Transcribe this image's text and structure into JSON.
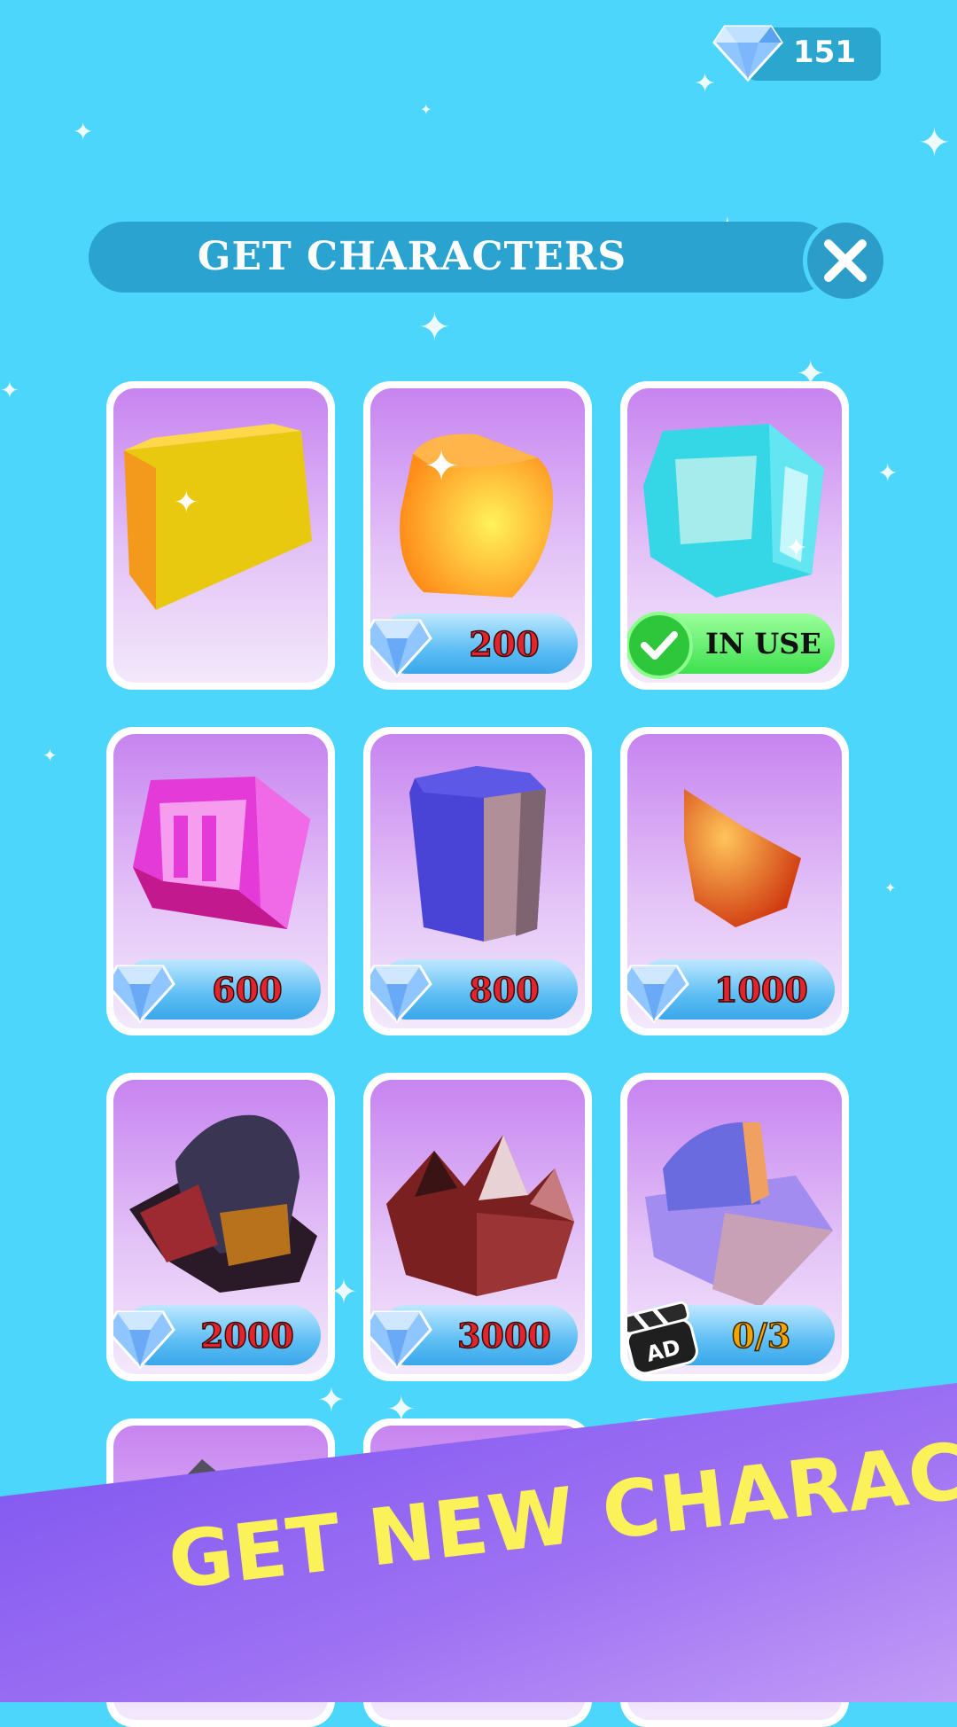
{
  "currency": {
    "gem_count": "151",
    "icon": "diamond-icon"
  },
  "header": {
    "title": "GET CHARACTERS",
    "close_icon": "close-icon"
  },
  "characters": [
    {
      "id": "yellow-cube",
      "status": "owned",
      "label": ""
    },
    {
      "id": "orange-cube",
      "status": "price",
      "label": "200"
    },
    {
      "id": "cyan-gem",
      "status": "in_use",
      "label": "IN USE"
    },
    {
      "id": "pink-gem",
      "status": "price",
      "label": "600"
    },
    {
      "id": "blue-prism",
      "status": "price",
      "label": "800"
    },
    {
      "id": "orange-shard",
      "status": "price",
      "label": "1000"
    },
    {
      "id": "dark-rock",
      "status": "price",
      "label": "2000"
    },
    {
      "id": "red-crown",
      "status": "price",
      "label": "3000"
    },
    {
      "id": "lilac-block",
      "status": "ad",
      "label": "0/3",
      "badge": "AD"
    }
  ],
  "promo": {
    "text": "GET NEW CHARACTERS"
  },
  "colors": {
    "background": "#4cd6fb",
    "header_bar": "#2aa3d0",
    "price_text": "#e0252c",
    "in_use_pill": "#3ee04f",
    "promo_text": "#fbf25a"
  }
}
